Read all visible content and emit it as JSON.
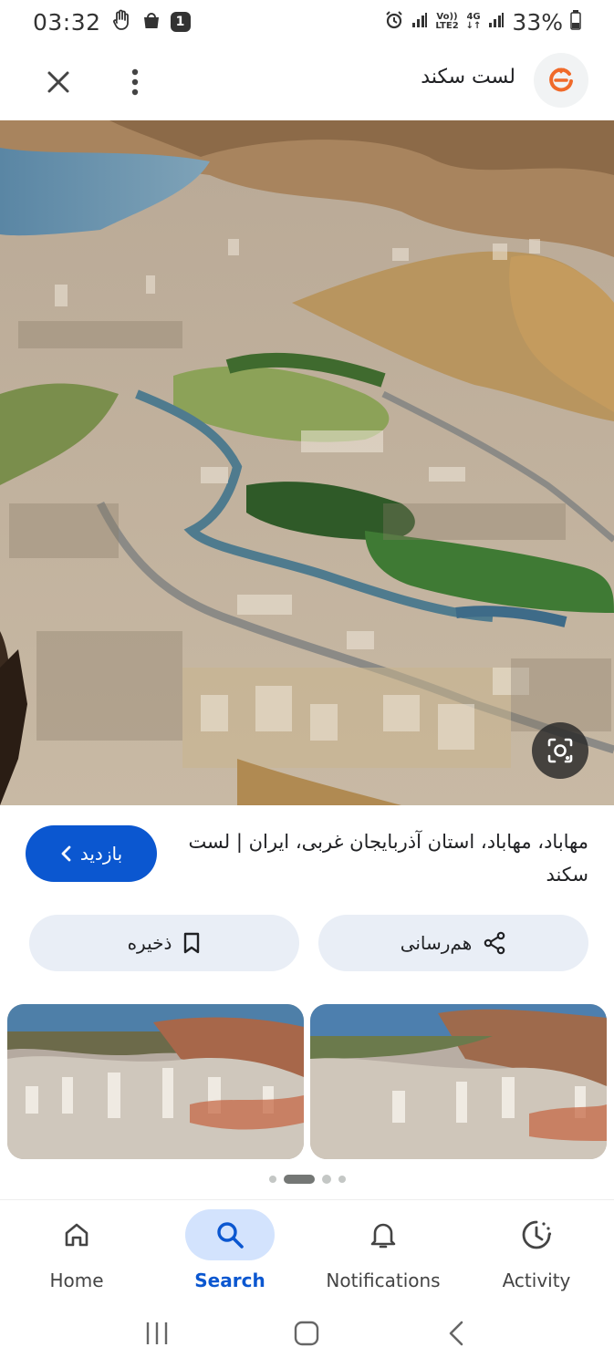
{
  "status_bar": {
    "time": "03:32",
    "notification_count": "1",
    "network_top": "Vo))",
    "network_bottom": "LTE2",
    "network_type": "4G",
    "battery": "33%"
  },
  "top_bar": {
    "site_name": "لست سکند",
    "icons": [
      "close-icon",
      "more-vert-icon",
      "site-logo"
    ]
  },
  "hero": {
    "icons": [
      "lens-icon"
    ]
  },
  "caption": {
    "title": "مهاباد، مهاباد، استان آذربایجان غربی، ایران | لست سکند"
  },
  "buttons": {
    "visit_label": "بازدید",
    "share_label": "هم‌رسانی",
    "save_label": "ذخیره"
  },
  "carousel": {
    "pages": 4,
    "active_page": 2
  },
  "bottom_nav": {
    "items": [
      {
        "label": "Home",
        "icon": "home-icon"
      },
      {
        "label": "Search",
        "icon": "search-icon"
      },
      {
        "label": "Notifications",
        "icon": "bell-icon"
      },
      {
        "label": "Activity",
        "icon": "activity-icon"
      }
    ],
    "active": "Search"
  },
  "colors": {
    "accent": "#0b57d0",
    "chip_bg": "#e9eef6",
    "nav_active_bg": "#d3e3fd"
  }
}
